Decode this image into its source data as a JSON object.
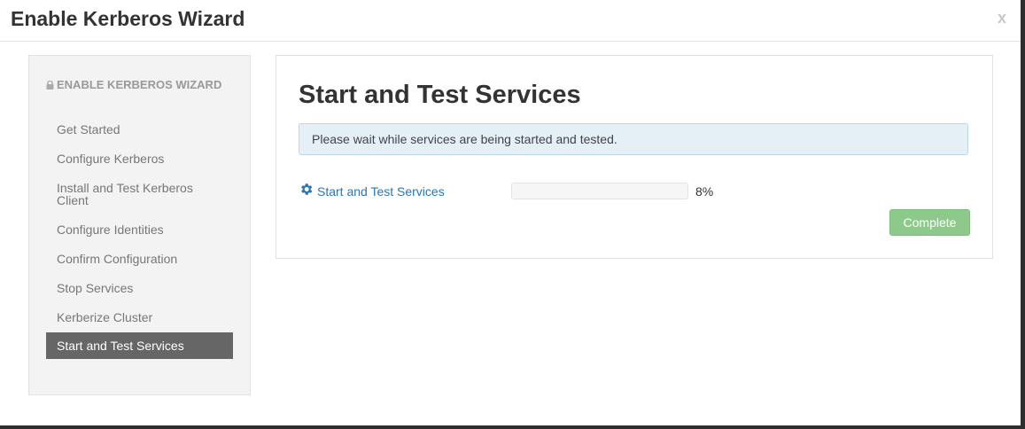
{
  "modal": {
    "title": "Enable Kerberos Wizard",
    "close_label": "x"
  },
  "sidebar": {
    "heading": "ENABLE KERBEROS WIZARD",
    "heading_icon": "lock-icon",
    "items": [
      {
        "label": "Get Started"
      },
      {
        "label": "Configure Kerberos"
      },
      {
        "label": "Install and Test Kerberos Client"
      },
      {
        "label": "Configure Identities"
      },
      {
        "label": "Confirm Configuration"
      },
      {
        "label": "Stop Services"
      },
      {
        "label": "Kerberize Cluster"
      },
      {
        "label": "Start and Test Services",
        "active": true
      }
    ]
  },
  "main": {
    "title": "Start and Test Services",
    "info_message": "Please wait while services are being started and tested.",
    "task": {
      "icon": "gear-icon",
      "label": "Start and Test Services",
      "progress_percent": 8,
      "progress_text": "8%"
    },
    "complete_button": "Complete"
  },
  "colors": {
    "accent_link": "#2a76b3",
    "active_nav_bg": "#666666",
    "complete_button_bg": "#8ec98c",
    "info_bg": "#e4eff6"
  }
}
